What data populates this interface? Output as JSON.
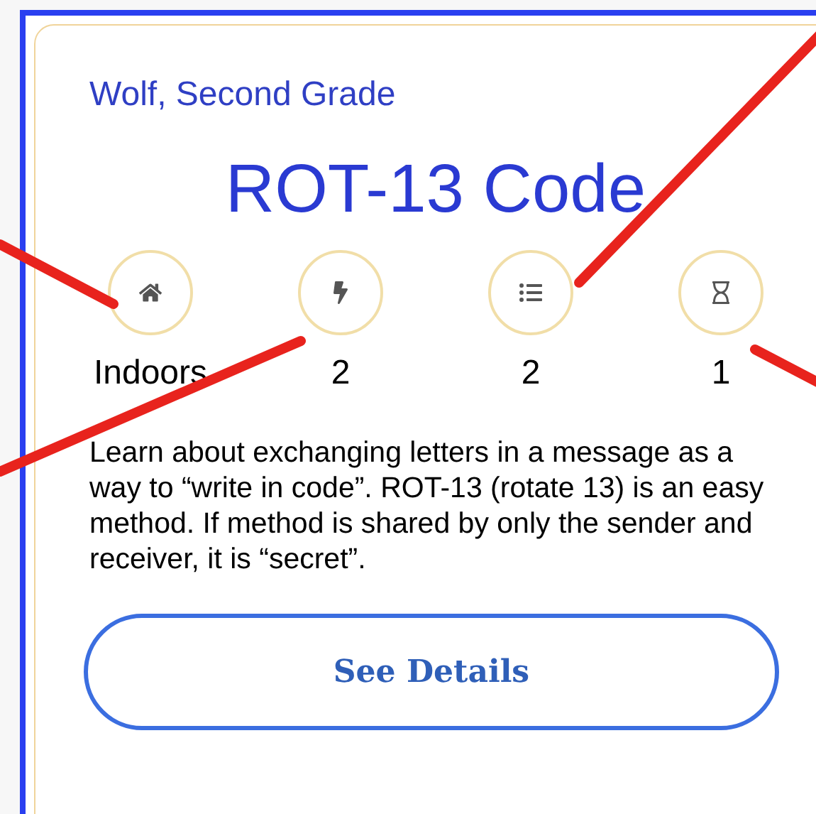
{
  "card": {
    "subtitle": "Wolf, Second Grade",
    "title": "ROT-13 Code",
    "stats": [
      {
        "label": "Indoors"
      },
      {
        "label": "2"
      },
      {
        "label": "2"
      },
      {
        "label": "1"
      }
    ],
    "description": "Learn about exchanging letters in a message as a way to “write in code”.  ROT-13 (rotate 13) is an easy method. If method is shared by only the sender and receiver, it is “secret”.",
    "button": "See Details"
  }
}
